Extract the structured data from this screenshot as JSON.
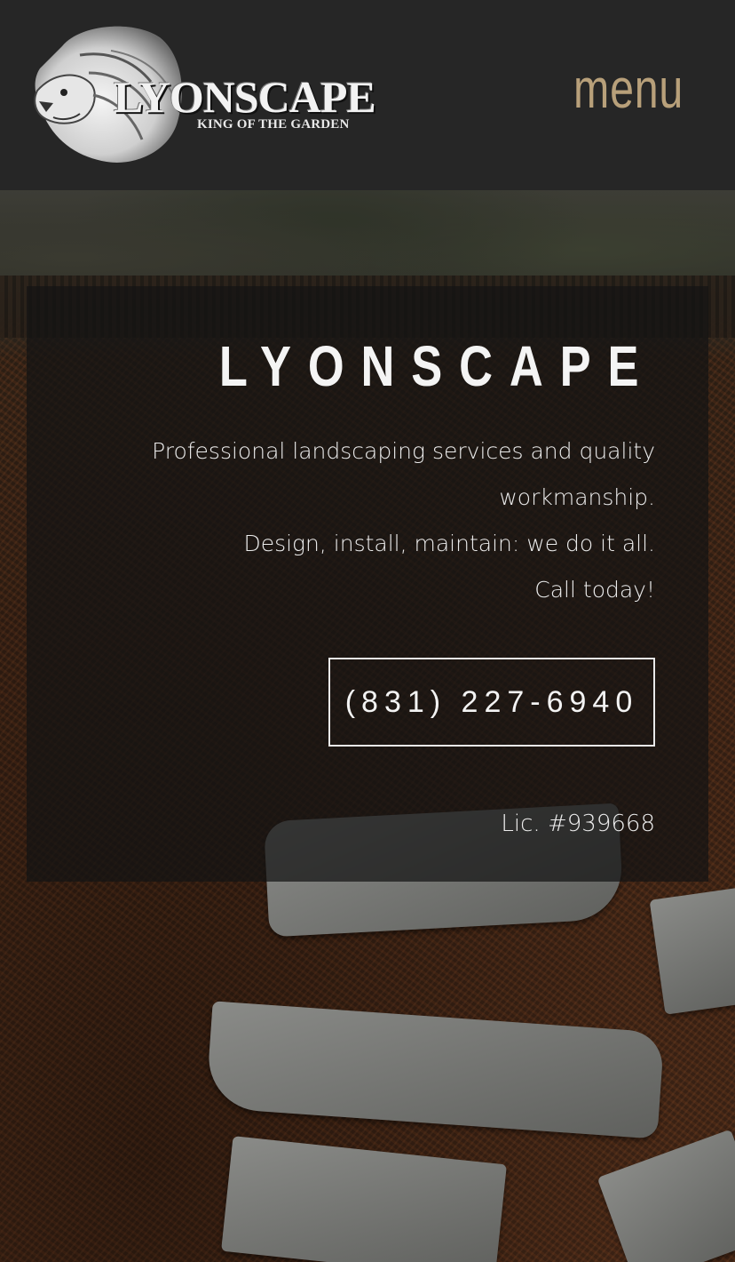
{
  "header": {
    "logo": {
      "wordmark": "LYONSCAPE",
      "tagline": "KING OF THE GARDEN"
    },
    "menu_label": "menu"
  },
  "hero": {
    "title": "LYONSCAPE",
    "description": [
      "Professional landscaping services and quality workmanship.",
      "Design, install, maintain: we do it all.",
      "Call today!"
    ],
    "phone": "(831) 227-6940",
    "license": "Lic. #939668"
  },
  "colors": {
    "header_bg": "#262626",
    "menu_accent": "#b8a07a",
    "overlay": "rgba(20,20,20,0.72)",
    "text": "#f4f4f4"
  }
}
